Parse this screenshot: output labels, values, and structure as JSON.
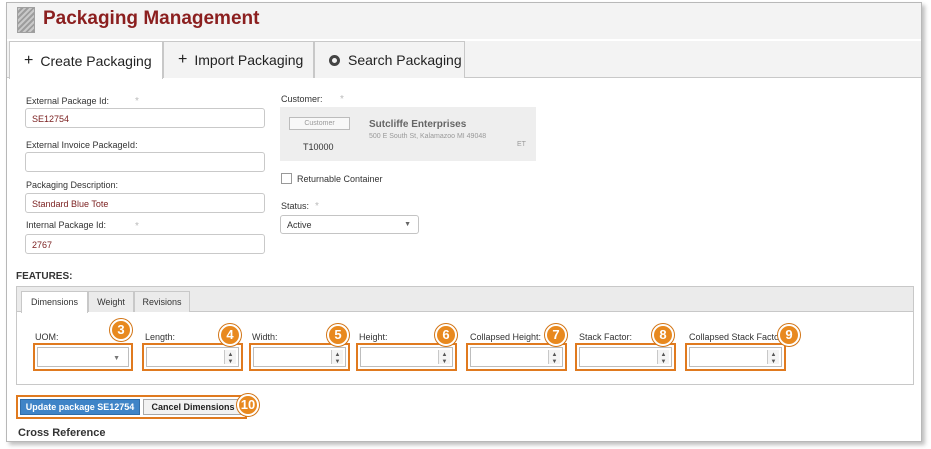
{
  "app": {
    "title": "Packaging Management"
  },
  "tabs": [
    {
      "label": "Create Packaging",
      "glyph": "+"
    },
    {
      "label": "Import Packaging",
      "glyph": "+"
    },
    {
      "label": "Search Packaging",
      "icon": "gear-icon"
    }
  ],
  "form": {
    "external_package_id": {
      "label": "External Package Id:",
      "value": "SE12754"
    },
    "external_invoice_package_id": {
      "label": "External Invoice PackageId:",
      "value": ""
    },
    "packaging_description": {
      "label": "Packaging Description:",
      "value": "Standard Blue Tote"
    },
    "internal_package_id": {
      "label": "Internal Package Id:",
      "value": "2767"
    },
    "required_marker": "*"
  },
  "customer": {
    "label": "Customer:",
    "button_label": "Customer",
    "id": "T10000",
    "name": "Sutcliffe Enterprises",
    "address": "500 E South St, Kalamazoo MI 49048",
    "tag": "ET"
  },
  "returnable": {
    "label": "Returnable Container",
    "checked": false
  },
  "status": {
    "label": "Status:",
    "value": "Active"
  },
  "features": {
    "title": "FEATURES:",
    "tabs": [
      "Dimensions",
      "Weight",
      "Revisions"
    ],
    "fields": [
      {
        "label": "UOM:",
        "value": "",
        "badge": "3"
      },
      {
        "label": "Length:",
        "value": "",
        "badge": "4"
      },
      {
        "label": "Width:",
        "value": "",
        "badge": "5"
      },
      {
        "label": "Height:",
        "value": "",
        "badge": "6"
      },
      {
        "label": "Collapsed Height:",
        "value": "",
        "badge": "7"
      },
      {
        "label": "Stack Factor:",
        "value": "",
        "badge": "8"
      },
      {
        "label": "Collapsed Stack Facto",
        "value": "",
        "badge": "9"
      }
    ]
  },
  "actions": {
    "update_label": "Update package SE12754",
    "cancel_label": "Cancel Dimensions",
    "badge": "10"
  },
  "cross_reference": {
    "title": "Cross Reference"
  },
  "colors": {
    "title": "#8b1f1f",
    "highlight": "#e07a1f",
    "primary": "#3f84c7"
  }
}
